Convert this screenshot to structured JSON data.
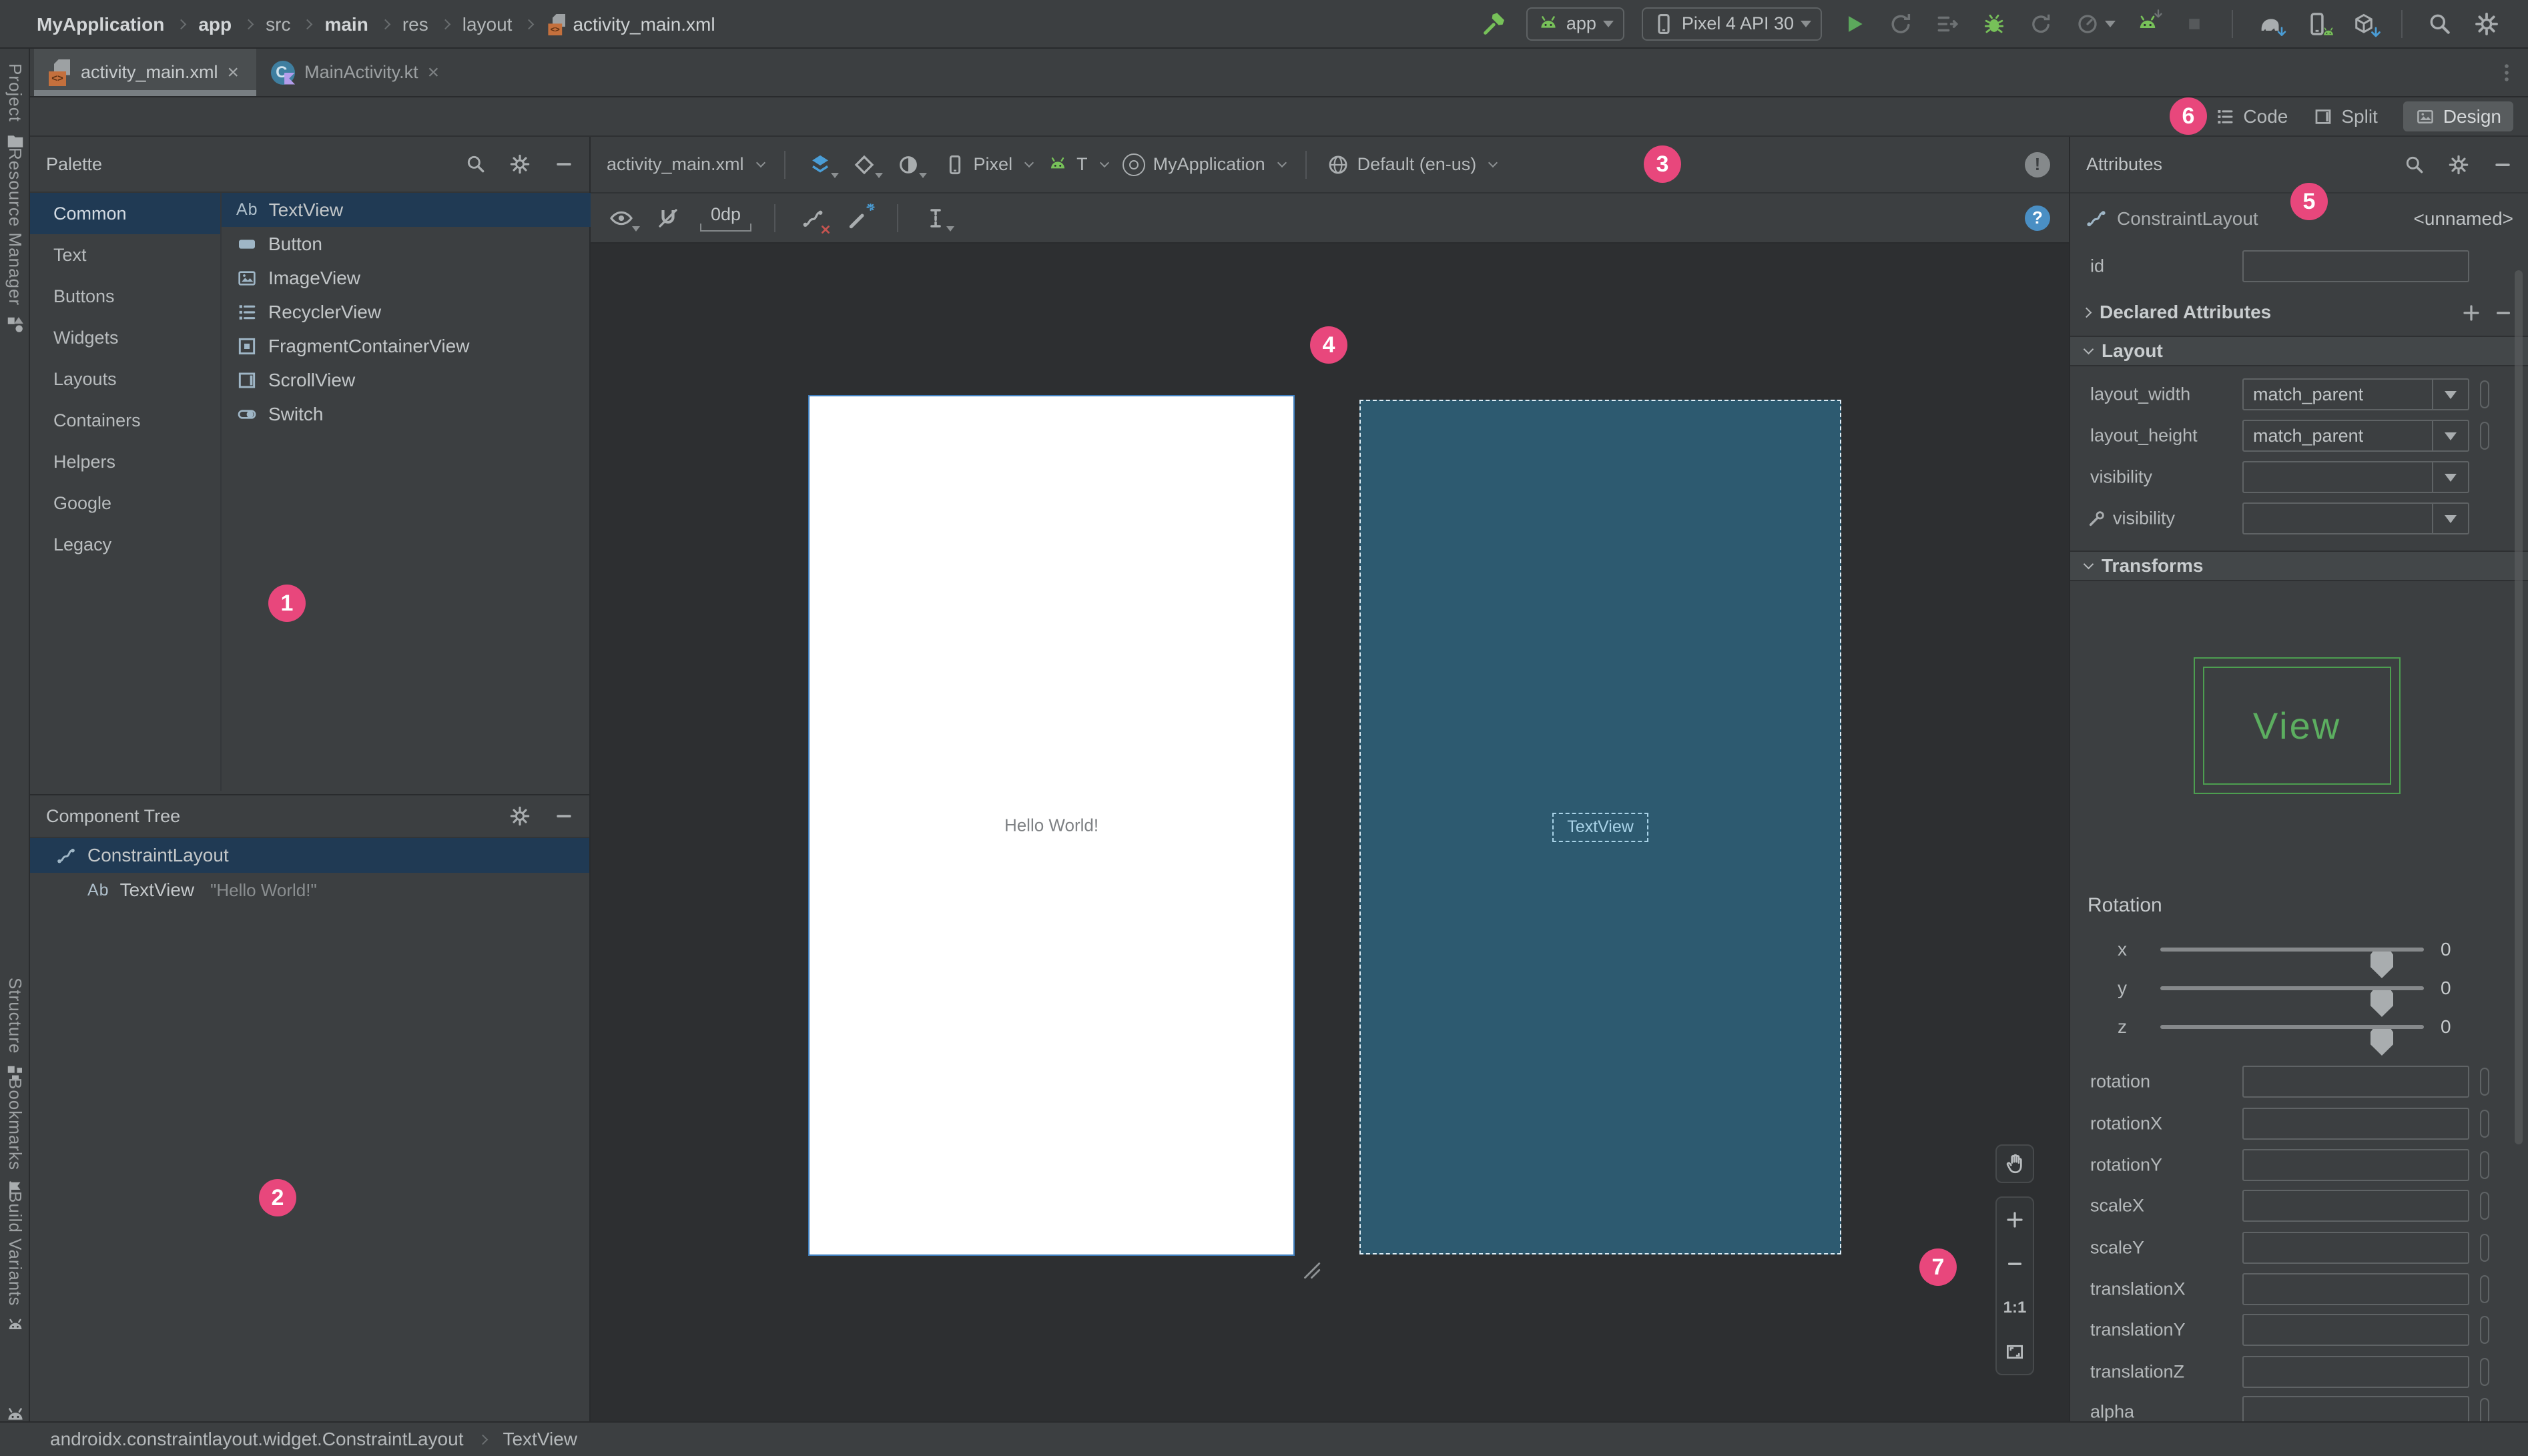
{
  "colors": {
    "accent_pink": "#E8477C",
    "selection_blue": "#203A54",
    "blueprint_bg": "#2D5A70",
    "panel_bg": "#3C3F41",
    "canvas_bg": "#2D2F31",
    "android_green": "#77C159",
    "icon_blue": "#4A9DD6",
    "view_preview_green": "#4D9E50"
  },
  "icons": {
    "close": "×",
    "help": "?",
    "alert": "!"
  },
  "topbar": {
    "breadcrumbs": [
      {
        "label": "MyApplication",
        "bold": true
      },
      {
        "label": "app",
        "bold": true
      },
      {
        "label": "src",
        "bold": false
      },
      {
        "label": "main",
        "bold": true
      },
      {
        "label": "res",
        "bold": false
      },
      {
        "label": "layout",
        "bold": false
      },
      {
        "label": "activity_main.xml",
        "bold": false
      }
    ],
    "run_config": "app",
    "device": "Pixel 4 API 30"
  },
  "tabs": [
    {
      "label": "activity_main.xml",
      "active": true
    },
    {
      "label": "MainActivity.kt",
      "active": false
    }
  ],
  "left_stripe": {
    "items": [
      {
        "label": "Project"
      },
      {
        "label": "Resource Manager"
      },
      {
        "label": "Structure"
      },
      {
        "label": "Bookmarks"
      },
      {
        "label": "Build Variants"
      }
    ]
  },
  "mode_switch": {
    "items": [
      {
        "label": "Code",
        "active": false
      },
      {
        "label": "Split",
        "active": false
      },
      {
        "label": "Design",
        "active": true
      }
    ]
  },
  "palette": {
    "title": "Palette",
    "ab_glyph": "Ab",
    "categories": [
      {
        "label": "Common",
        "active": true
      },
      {
        "label": "Text",
        "active": false
      },
      {
        "label": "Buttons",
        "active": false
      },
      {
        "label": "Widgets",
        "active": false
      },
      {
        "label": "Layouts",
        "active": false
      },
      {
        "label": "Containers",
        "active": false
      },
      {
        "label": "Helpers",
        "active": false
      },
      {
        "label": "Google",
        "active": false
      },
      {
        "label": "Legacy",
        "active": false
      }
    ],
    "components": [
      {
        "label": "TextView",
        "active": true
      },
      {
        "label": "Button",
        "active": false
      },
      {
        "label": "ImageView",
        "active": false
      },
      {
        "label": "RecyclerView",
        "active": false
      },
      {
        "label": "FragmentContainerView",
        "active": false
      },
      {
        "label": "ScrollView",
        "active": false
      },
      {
        "label": "Switch",
        "active": false
      }
    ]
  },
  "component_tree": {
    "title": "Component Tree",
    "items": [
      {
        "label": "ConstraintLayout",
        "value": "",
        "active": true
      },
      {
        "label": "TextView",
        "value": "\"Hello World!\"",
        "active": false
      }
    ]
  },
  "design_toolbar": {
    "file": "activity_main.xml",
    "device": "Pixel",
    "api": "T",
    "theme": "MyApplication",
    "locale": "Default (en-us)",
    "default_margin": "0dp"
  },
  "canvas": {
    "design_text": "Hello World!",
    "blueprint_component": "TextView"
  },
  "zoom_controls": {
    "one_to_one": "1:1"
  },
  "attributes": {
    "title": "Attributes",
    "component": "ConstraintLayout",
    "instance": "<unnamed>",
    "id_label": "id",
    "declared_section": "Declared Attributes",
    "layout_section": "Layout",
    "rows": [
      {
        "label": "layout_width",
        "value": "match_parent"
      },
      {
        "label": "layout_height",
        "value": "match_parent"
      },
      {
        "label": "visibility",
        "value": ""
      },
      {
        "label": "visibility",
        "value": ""
      }
    ],
    "transforms_section": "Transforms",
    "view_preview": "View",
    "rotation": {
      "label": "Rotation",
      "axes": [
        {
          "axis": "x",
          "value": "0"
        },
        {
          "axis": "y",
          "value": "0"
        },
        {
          "axis": "z",
          "value": "0"
        }
      ]
    },
    "fields": [
      {
        "label": "rotation",
        "value": ""
      },
      {
        "label": "rotationX",
        "value": ""
      },
      {
        "label": "rotationY",
        "value": ""
      },
      {
        "label": "scaleX",
        "value": ""
      },
      {
        "label": "scaleY",
        "value": ""
      },
      {
        "label": "translationX",
        "value": ""
      },
      {
        "label": "translationY",
        "value": ""
      },
      {
        "label": "translationZ",
        "value": ""
      },
      {
        "label": "alpha",
        "value": ""
      }
    ]
  },
  "status_bar": {
    "path": [
      "androidx.constraintlayout.widget.ConstraintLayout",
      "TextView"
    ]
  },
  "badges": [
    "1",
    "2",
    "3",
    "4",
    "5",
    "6",
    "7"
  ]
}
